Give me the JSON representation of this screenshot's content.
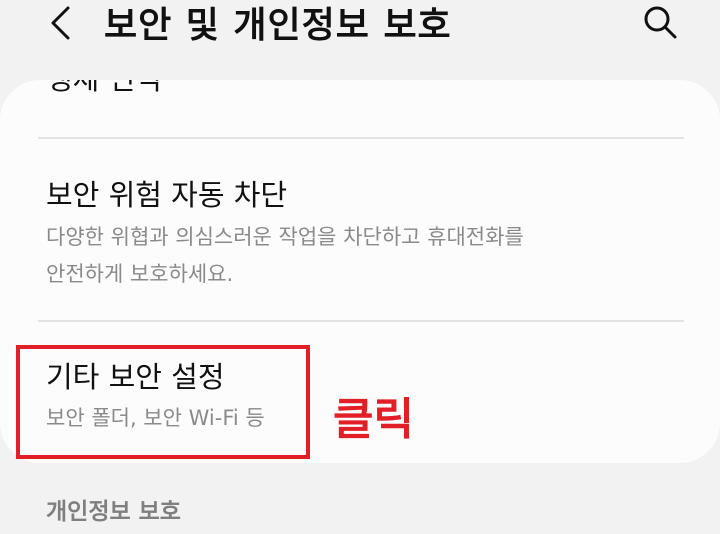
{
  "header": {
    "back_icon": "chevron-left-icon",
    "title": "보안 및 개인정보 보호",
    "search_icon": "search-icon"
  },
  "items": [
    {
      "title": "생체 인식"
    },
    {
      "title": "보안 위험 자동 차단",
      "subtitle_line1": "다양한 위협과 의심스러운 작업을 차단하고 휴대전화를",
      "subtitle_line2": "안전하게 보호하세요."
    },
    {
      "title": "기타 보안 설정",
      "subtitle": "보안 폴더, 보안 Wi-Fi 등"
    }
  ],
  "annotation": {
    "label": "클릭",
    "color": "#e21f26"
  },
  "section": {
    "title": "개인정보 보호"
  }
}
